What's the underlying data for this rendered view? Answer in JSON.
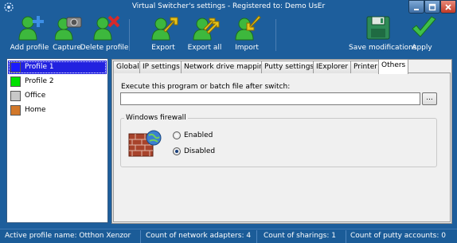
{
  "window": {
    "title": "Virtual Switcher's settings - Registered to: Demo UsEr"
  },
  "toolbar": {
    "add_profile": "Add profile",
    "capture": "Capture",
    "delete_profile": "Delete profile",
    "export": "Export",
    "export_all": "Export all",
    "import": "Import",
    "save_modifications": "Save modifications",
    "apply": "Apply"
  },
  "profiles": [
    {
      "label": "Profile 1",
      "color": "#1a1aff",
      "selected": true
    },
    {
      "label": "Profile 2",
      "color": "#00e000",
      "selected": false
    },
    {
      "label": "Office",
      "color": "#c8c8c8",
      "selected": false
    },
    {
      "label": "Home",
      "color": "#d2782a",
      "selected": false
    }
  ],
  "tabs": [
    "Global",
    "IP settings",
    "Network drive mapping",
    "Putty settings",
    "IExplorer",
    "Printer",
    "Others"
  ],
  "active_tab": "Others",
  "others": {
    "execute_label": "Execute this program or batch file after switch:",
    "execute_value": "",
    "browse_label": "...",
    "firewall_group_title": "Windows firewall",
    "enabled_label": "Enabled",
    "disabled_label": "Disabled",
    "firewall_state": "Disabled"
  },
  "statusbar": {
    "active_profile": "Active profile name: Otthon Xenzor",
    "adapters": "Count of network adapters: 4",
    "sharings": "Count of sharings: 1",
    "putty": "Count of putty accounts: 0"
  },
  "colors": {
    "background": "#1d5e9c",
    "selection": "#2222e0",
    "accent_green": "#3db83d",
    "accent_yellow": "#e6c21c",
    "delete_red": "#d62a2a"
  }
}
